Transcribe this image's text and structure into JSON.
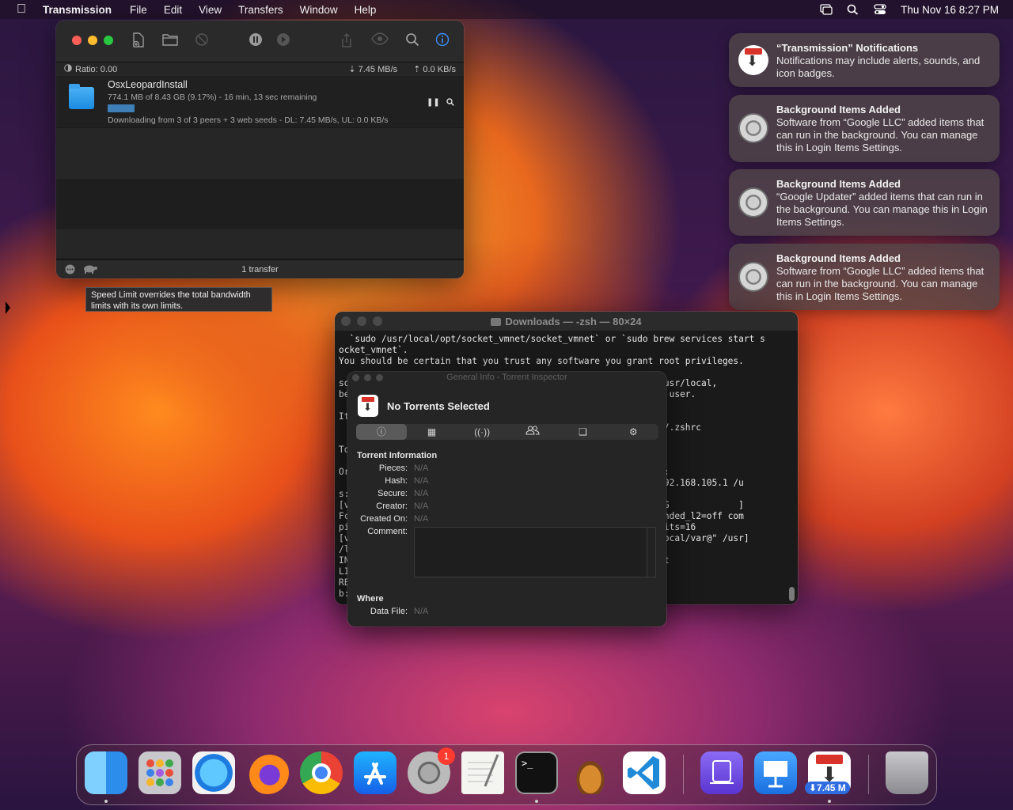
{
  "menubar": {
    "app_name": "Transmission",
    "items": [
      "File",
      "Edit",
      "View",
      "Transfers",
      "Window",
      "Help"
    ],
    "clock": "Thu Nov 16  8:27 PM"
  },
  "transmission": {
    "ratio": "Ratio: 0.00",
    "download_speed": "7.45 MB/s",
    "upload_speed": "0.0 KB/s",
    "torrent": {
      "name": "OsxLeopardInstall",
      "progress_text": "774.1 MB of 8.43 GB (9.17%) - 16 min, 13 sec remaining",
      "progress_fraction": 0.0917,
      "status_text": "Downloading from 3 of 3 peers + 3 web seeds - DL: 7.45 MB/s, UL: 0.0 KB/s"
    },
    "transfer_count": "1 transfer",
    "tooltip": "Speed Limit overrides the total bandwidth limits with its own limits."
  },
  "notifications": [
    {
      "title": "“Transmission” Notifications",
      "body": "Notifications may include alerts, sounds, and icon badges."
    },
    {
      "title": "Background Items Added",
      "body": "Software from “Google LLC” added items that can run in the background. You can manage this in Login Items Settings."
    },
    {
      "title": "Background Items Added",
      "body": "“Google Updater” added items that can run in the background. You can manage this in Login Items Settings."
    },
    {
      "title": "Background Items Added",
      "body": "Software from “Google LLC” added items that can run in the background. You can manage this in Login Items Settings."
    }
  ],
  "terminal": {
    "title": "Downloads — -zsh — 80×24",
    "lines": [
      "  `sudo /usr/local/opt/socket_vmnet/socket_vmnet` or `sudo brew services start s",
      "ocket_vmnet`.",
      "You should be certain that you trust any software you grant root privileges.",
      "",
      "so                                                     into /usr/local,",
      "be                                                     -admin user.",
      "",
      "It",
      "                                                       ' >> ~/.zshrc",
      "",
      "To",
      "",
      "Or                                                      t run:",
      "                                                       way\\=192.168.105.1 /u",
      "s:",
      "[vr                                                    ow2 60G             ]",
      "Fc                                                     5 extended_l2=off com",
      "pi                                                     ount_bits=16",
      "[vr                                                    /usr/local/var@\" /usr]",
      "/l",
      "IN                                                     t.plist",
      "LI                                                     vice",
      "RE",
      "b:"
    ]
  },
  "inspector": {
    "title": "General Info - Torrent Inspector",
    "header": "No Torrents Selected",
    "section_info": "Torrent Information",
    "fields": [
      {
        "label": "Pieces:",
        "value": "N/A"
      },
      {
        "label": "Hash:",
        "value": "N/A"
      },
      {
        "label": "Secure:",
        "value": "N/A"
      },
      {
        "label": "Creator:",
        "value": "N/A"
      },
      {
        "label": "Created On:",
        "value": "N/A"
      }
    ],
    "comment_label": "Comment:",
    "section_where": "Where",
    "data_file_label": "Data File:",
    "data_file_value": "N/A"
  },
  "dock": {
    "settings_badge": "1",
    "transmission_speed": "⬇7.45 M"
  },
  "colors": {
    "accent_blue": "#3d8dff",
    "badge_red": "#ff3b30",
    "progress_blue": "#3e7fb8"
  }
}
